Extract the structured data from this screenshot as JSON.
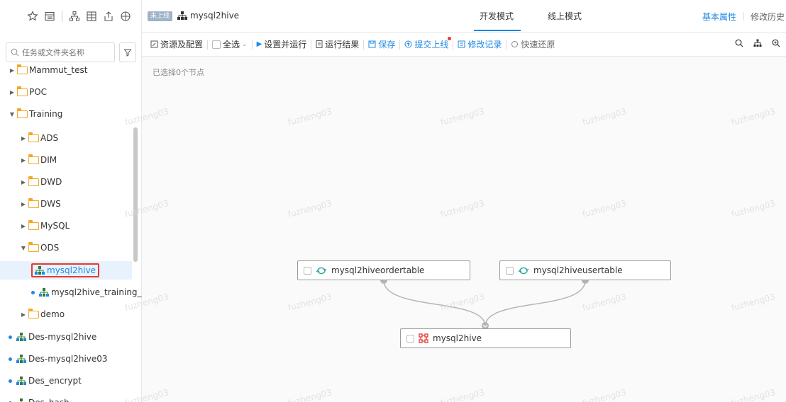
{
  "sidebar": {
    "icons": [
      "star-icon",
      "list-icon",
      "tree-icon",
      "grid-icon",
      "export-icon",
      "compass-icon"
    ],
    "search_placeholder": "任务或文件夹名称",
    "tree": [
      {
        "label": "Mammut_test",
        "type": "folder",
        "expanded": false
      },
      {
        "label": "POC",
        "type": "folder",
        "expanded": false
      },
      {
        "label": "Training",
        "type": "folder",
        "expanded": true
      },
      {
        "label": "ADS",
        "type": "folder",
        "expanded": false
      },
      {
        "label": "DIM",
        "type": "folder",
        "expanded": false
      },
      {
        "label": "DWD",
        "type": "folder",
        "expanded": false
      },
      {
        "label": "DWS",
        "type": "folder",
        "expanded": false
      },
      {
        "label": "MySQL",
        "type": "folder",
        "expanded": false
      },
      {
        "label": "ODS",
        "type": "folder",
        "expanded": true
      },
      {
        "label": "mysql2hive",
        "type": "workflow",
        "selected": true
      },
      {
        "label": "mysql2hive_training_",
        "type": "workflow"
      },
      {
        "label": "demo",
        "type": "folder",
        "expanded": false
      },
      {
        "label": "Des-mysql2hive",
        "type": "workflow"
      },
      {
        "label": "Des-mysql2hive03",
        "type": "workflow"
      },
      {
        "label": "Des_encrypt",
        "type": "workflow"
      },
      {
        "label": "Des_hash",
        "type": "workflow"
      }
    ]
  },
  "header": {
    "status_tag": "未上线",
    "workflow_name": "mysql2hive",
    "tabs": [
      "开发模式",
      "线上模式"
    ],
    "active_tab": "开发模式",
    "right_links": [
      "基本属性",
      "修改历史"
    ]
  },
  "toolbar": {
    "resources": "资源及配置",
    "select_all": "全选",
    "set_run": "设置并运行",
    "run_result": "运行结果",
    "save": "保存",
    "submit_online": "提交上线",
    "modify_log": "修改记录",
    "quick_restore": "快速还原"
  },
  "canvas": {
    "selected_count": "已选择0个节点",
    "watermark": "fuzheng03",
    "nodes": [
      {
        "label": "mysql2hiveordertable",
        "kind": "sync"
      },
      {
        "label": "mysql2hiveusertable",
        "kind": "sync"
      },
      {
        "label": "mysql2hive",
        "kind": "transform"
      }
    ]
  },
  "colors": {
    "accent": "#1e88e5",
    "folder": "#f5a623",
    "highlight": "#e53935"
  }
}
